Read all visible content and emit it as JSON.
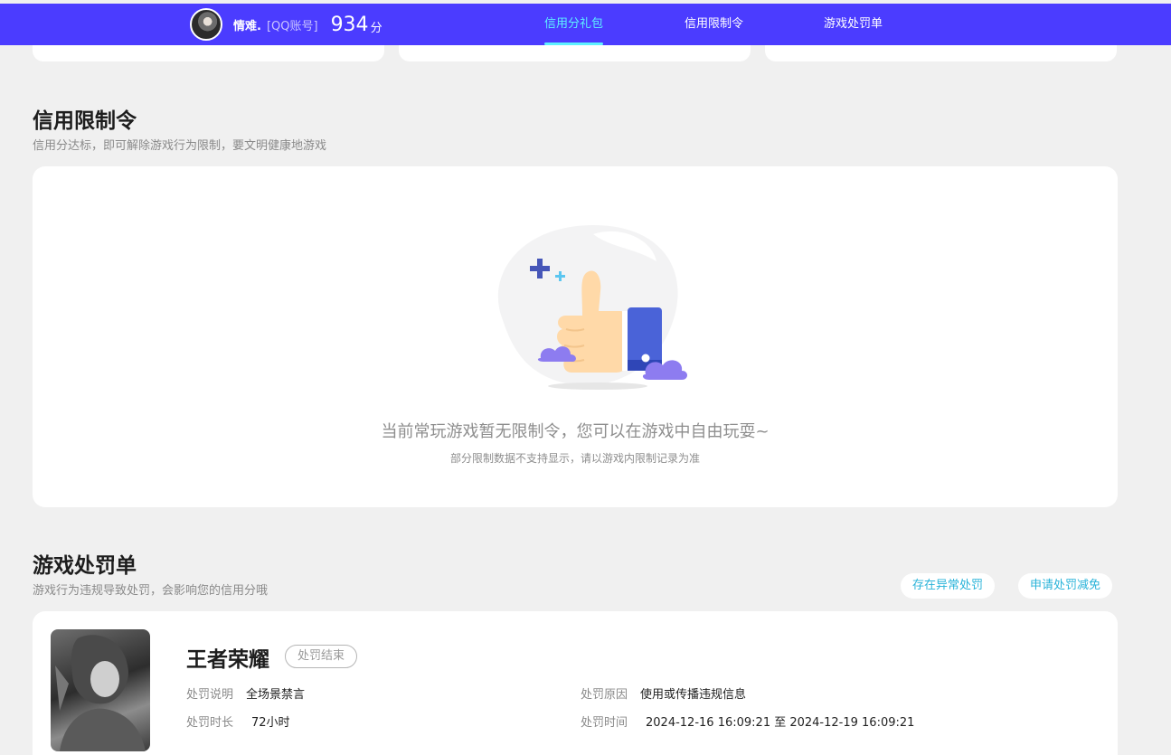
{
  "header": {
    "nickname": "情难.",
    "account_type": "[QQ账号]",
    "score": "934",
    "score_unit": "分",
    "nav": [
      {
        "label": "信用分礼包",
        "active": true
      },
      {
        "label": "信用限制令",
        "active": false
      },
      {
        "label": "游戏处罚单",
        "active": false
      }
    ]
  },
  "restriction": {
    "title": "信用限制令",
    "subtitle": "信用分达标，即可解除游戏行为限制，要文明健康地游戏",
    "empty_message": "当前常玩游戏暂无限制令，您可以在游戏中自由玩耍~",
    "empty_note": "部分限制数据不支持显示，请以游戏内限制记录为准"
  },
  "penalty": {
    "title": "游戏处罚单",
    "subtitle": "游戏行为违规导致处罚，会影响您的信用分哦",
    "actions": {
      "abnormal": "存在异常处罚",
      "reduce": "申请处罚减免"
    },
    "record": {
      "game": "王者荣耀",
      "status": "处罚结束",
      "desc_label": "处罚说明",
      "desc_value": "全场景禁言",
      "reason_label": "处罚原因",
      "reason_value": "使用或传播违规信息",
      "duration_label": "处罚时长",
      "duration_value": "72小时",
      "time_label": "处罚时间",
      "time_value": "2024-12-16 16:09:21 至 2024-12-19 16:09:21"
    }
  },
  "colors": {
    "topbar": "#4b3cff",
    "active_nav": "#5ef1ff",
    "link": "#29b3d9"
  }
}
